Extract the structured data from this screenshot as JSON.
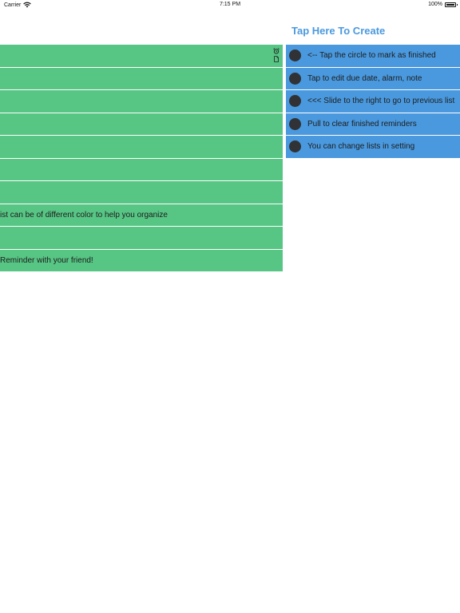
{
  "status_bar": {
    "carrier": "Carrier",
    "time": "7:15 PM",
    "battery": "100%",
    "battery_level": 1.0
  },
  "header": {
    "create_label": "Tap Here To Create"
  },
  "colors": {
    "left_list_bg": "#57c584",
    "right_list_bg": "#4a99de",
    "accent": "#4a99de",
    "circle": "#303236"
  },
  "left_list": {
    "rows": [
      {
        "text": "",
        "icons": [
          "alarm-icon",
          "note-icon"
        ]
      },
      {
        "text": ""
      },
      {
        "text": ""
      },
      {
        "text": ""
      },
      {
        "text": ""
      },
      {
        "text": ""
      },
      {
        "text": ""
      },
      {
        "text": "ist can be of different color to help you organize"
      },
      {
        "text": ""
      },
      {
        "text": "Reminder with your friend!"
      }
    ]
  },
  "right_list": {
    "rows": [
      {
        "text": "<-- Tap the circle to mark as finished"
      },
      {
        "text": "Tap to edit due date, alarm, note"
      },
      {
        "text": "<<< Slide to the right to go to previous list"
      },
      {
        "text": "Pull to clear finished reminders"
      },
      {
        "text": "You can change lists in setting"
      }
    ]
  }
}
